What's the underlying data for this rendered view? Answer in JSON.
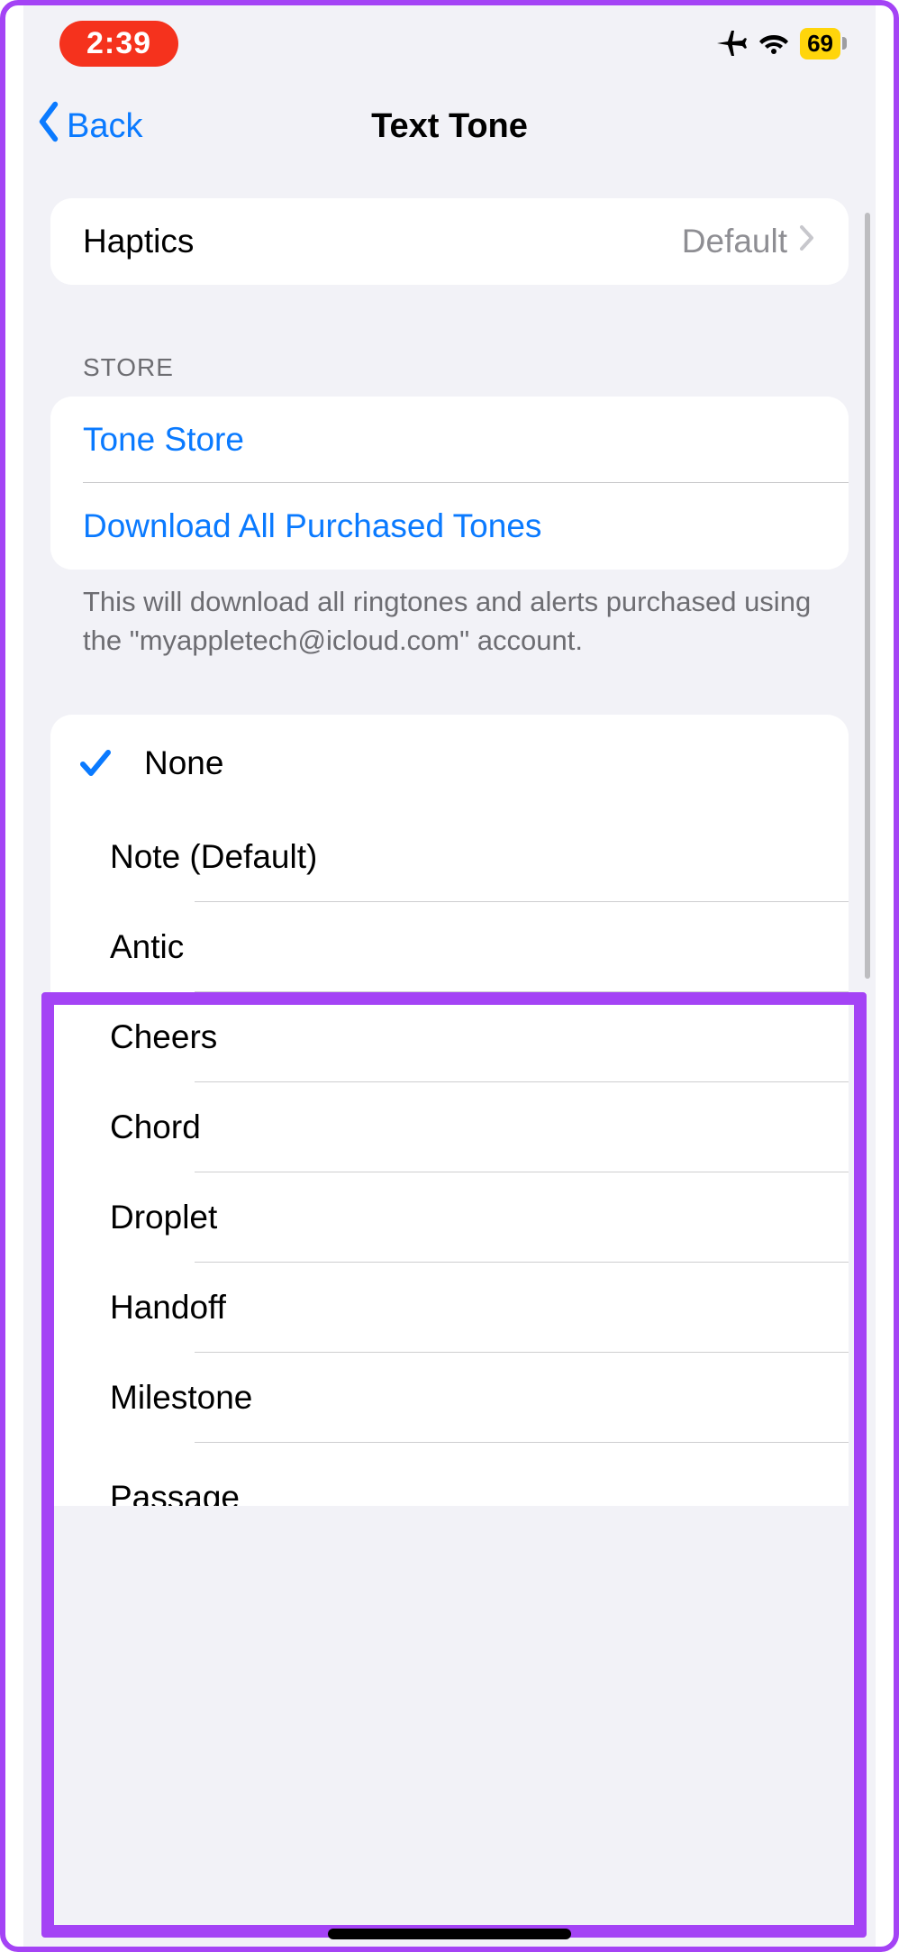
{
  "status": {
    "time": "2:39",
    "battery": "69"
  },
  "nav": {
    "back": "Back",
    "title": "Text Tone"
  },
  "haptics": {
    "label": "Haptics",
    "value": "Default"
  },
  "store_header": "STORE",
  "store": {
    "tone_store": "Tone Store",
    "download_all": "Download All Purchased Tones"
  },
  "store_footer": "This will download all ringtones and alerts purchased using the \"myappletech@icloud.com\" account.",
  "tones": {
    "selected": "None",
    "items": [
      "Note (Default)",
      "Antic",
      "Cheers",
      "Chord",
      "Droplet",
      "Handoff",
      "Milestone",
      "Passage"
    ]
  }
}
